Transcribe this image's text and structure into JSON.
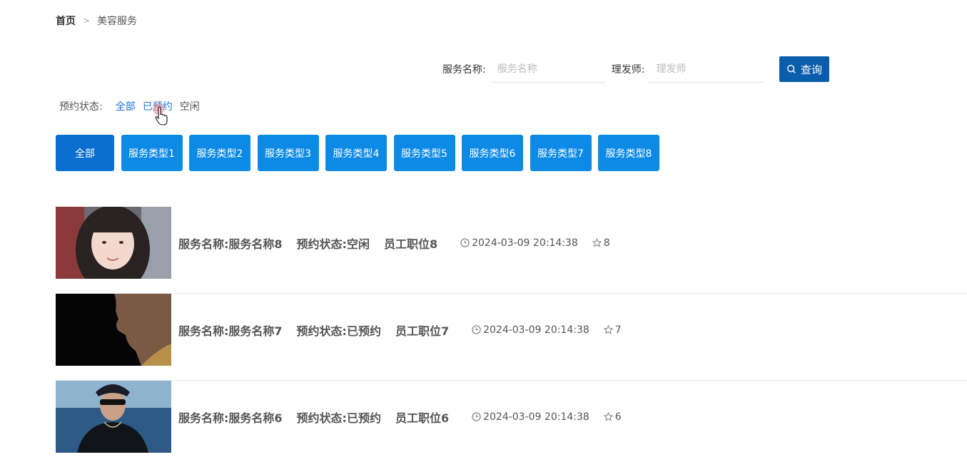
{
  "breadcrumb": {
    "home": "首页",
    "separator": ">",
    "current": "美容服务"
  },
  "search": {
    "service_label": "服务名称:",
    "service_placeholder": "服务名称",
    "stylist_label": "理发师:",
    "stylist_placeholder": "理发师",
    "button_label": "查询"
  },
  "status_filter": {
    "label": "预约状态:",
    "options": [
      "全部",
      "已预约",
      "空闲"
    ]
  },
  "categories": [
    "全部",
    "服务类型1",
    "服务类型2",
    "服务类型3",
    "服务类型4",
    "服务类型5",
    "服务类型6",
    "服务类型7",
    "服务类型8"
  ],
  "items": [
    {
      "name": "服务名称:服务名称8",
      "status": "预约状态:空闲",
      "position": "员工职位8",
      "time": "2024-03-09 20:14:38",
      "stars": "8"
    },
    {
      "name": "服务名称:服务名称7",
      "status": "预约状态:已预约",
      "position": "员工职位7",
      "time": "2024-03-09 20:14:38",
      "stars": "7"
    },
    {
      "name": "服务名称:服务名称6",
      "status": "预约状态:已预约",
      "position": "员工职位6",
      "time": "2024-03-09 20:14:38",
      "stars": "6"
    }
  ],
  "colors": {
    "primary": "#0a5dab",
    "category_button": "#0d8ae6",
    "link_blue": "#1a73d9"
  }
}
